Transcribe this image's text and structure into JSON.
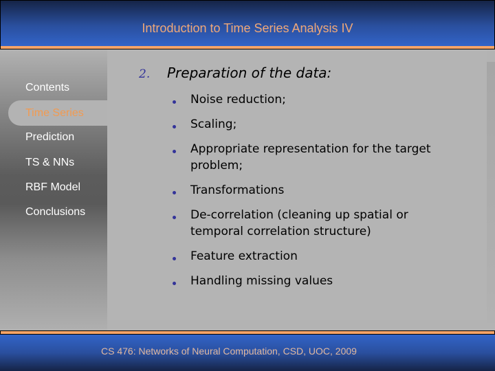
{
  "header": {
    "title": "Introduction to Time Series Analysis IV"
  },
  "sidebar": {
    "items": [
      {
        "label": "Contents",
        "active": false
      },
      {
        "label": "Time Series",
        "active": true
      },
      {
        "label": "Prediction",
        "active": false
      },
      {
        "label": "TS & NNs",
        "active": false
      },
      {
        "label": "RBF Model",
        "active": false
      },
      {
        "label": "Conclusions",
        "active": false
      }
    ]
  },
  "main": {
    "section_number": "2.",
    "section_heading": "Preparation of the data:",
    "bullets": [
      "Noise reduction;",
      "Scaling;",
      "Appropriate representation for the target problem;",
      "Transformations",
      "De-correlation (cleaning up spatial or temporal correlation structure)",
      "Feature extraction",
      "Handling missing values"
    ]
  },
  "footer": {
    "text": "CS 476: Networks of Neural Computation, CSD, UOC, 2009"
  },
  "colors": {
    "accent_orange": "#f5a468",
    "header_blue": "#3264c8",
    "active_nav_text": "#f29a50",
    "bullet_color": "#333399"
  }
}
